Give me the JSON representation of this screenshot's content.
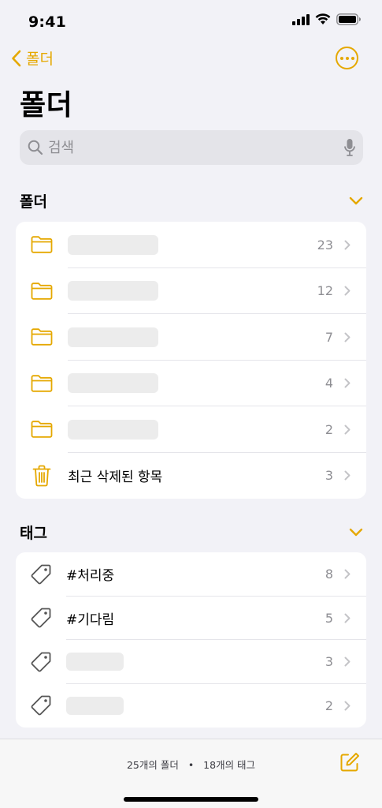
{
  "status": {
    "time": "9:41"
  },
  "nav": {
    "back_label": "폴더"
  },
  "title": "폴더",
  "search": {
    "placeholder": "검색"
  },
  "folders_section": {
    "title": "폴더",
    "items": [
      {
        "count": "23"
      },
      {
        "count": "12"
      },
      {
        "count": "7"
      },
      {
        "count": "4"
      },
      {
        "count": "2"
      },
      {
        "label": "최근 삭제된 항목",
        "count": "3"
      }
    ]
  },
  "tags_section": {
    "title": "태그",
    "items": [
      {
        "label": "#처리중",
        "count": "8"
      },
      {
        "label": "#기다림",
        "count": "5"
      },
      {
        "count": "3"
      },
      {
        "count": "2"
      }
    ]
  },
  "toolbar": {
    "folders_count": "25개의 폴더",
    "separator": "•",
    "tags_count": "18개의 태그"
  },
  "colors": {
    "accent": "#e5a800",
    "background": "#f2f2f7",
    "card": "#ffffff"
  }
}
